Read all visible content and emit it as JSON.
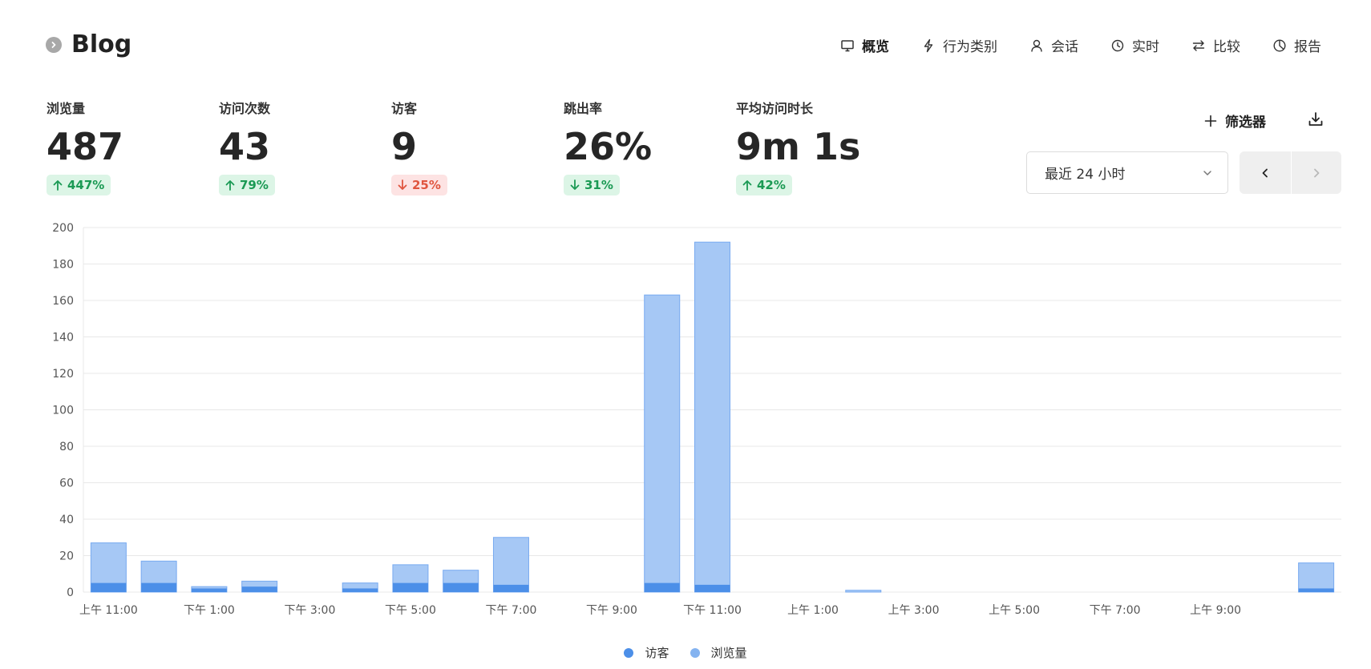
{
  "site": {
    "name": "Blog"
  },
  "nav": [
    {
      "label": "概览",
      "icon": "monitor-icon",
      "active": true
    },
    {
      "label": "行为类别",
      "icon": "bolt-icon"
    },
    {
      "label": "会话",
      "icon": "user-icon"
    },
    {
      "label": "实时",
      "icon": "clock-icon"
    },
    {
      "label": "比较",
      "icon": "swap-icon"
    },
    {
      "label": "报告",
      "icon": "pie-icon"
    }
  ],
  "metrics": [
    {
      "label": "浏览量",
      "value": "487",
      "change": "447%",
      "direction": "up"
    },
    {
      "label": "访问次数",
      "value": "43",
      "change": "79%",
      "direction": "up"
    },
    {
      "label": "访客",
      "value": "9",
      "change": "25%",
      "direction": "down"
    },
    {
      "label": "跳出率",
      "value": "26%",
      "change": "31%",
      "direction": "down"
    },
    {
      "label": "平均访问时长",
      "value": "9m 1s",
      "change": "42%",
      "direction": "up"
    }
  ],
  "toolbar": {
    "filter_label": "筛选器"
  },
  "range": {
    "selected": "最近 24 小时"
  },
  "colors": {
    "up_text": "#1b9a54",
    "down_text": "#e0553f",
    "visitors": "#4c8fe8",
    "pageviews": "#a6c8f5",
    "pageviews_stroke": "#78aaf0"
  },
  "chart_data": {
    "type": "bar",
    "stacked": "overlay",
    "ylim": [
      0,
      200
    ],
    "yticks": [
      0,
      20,
      40,
      60,
      80,
      100,
      120,
      140,
      160,
      180,
      200
    ],
    "categories": [
      "上午 11:00",
      "上午 12:00",
      "下午 1:00",
      "下午 2:00",
      "下午 3:00",
      "下午 4:00",
      "下午 5:00",
      "下午 6:00",
      "下午 7:00",
      "下午 8:00",
      "下午 9:00",
      "下午 10:00",
      "下午 11:00",
      "上午 12:00",
      "上午 1:00",
      "上午 2:00",
      "上午 3:00",
      "上午 4:00",
      "上午 5:00",
      "上午 6:00",
      "上午 7:00",
      "上午 8:00",
      "上午 9:00",
      "上午 10:00",
      "上午 11:00"
    ],
    "x_tick_labels": [
      "上午 11:00",
      "下午 1:00",
      "下午 3:00",
      "下午 5:00",
      "下午 7:00",
      "下午 9:00",
      "下午 11:00",
      "上午 1:00",
      "上午 3:00",
      "上午 5:00",
      "下午 7:00",
      "上午 9:00"
    ],
    "series": [
      {
        "name": "访客",
        "values": [
          5,
          5,
          2,
          3,
          0,
          2,
          5,
          5,
          4,
          0,
          0,
          5,
          4,
          0,
          0,
          0,
          0,
          0,
          0,
          0,
          0,
          0,
          0,
          0,
          2
        ]
      },
      {
        "name": "浏览量",
        "values": [
          27,
          17,
          3,
          6,
          0,
          5,
          15,
          12,
          30,
          0,
          0,
          163,
          192,
          0,
          0,
          1,
          0,
          0,
          0,
          0,
          0,
          0,
          0,
          0,
          16
        ]
      }
    ],
    "legend": [
      "访客",
      "浏览量"
    ],
    "grid": true,
    "legend_position": "bottom-center"
  }
}
